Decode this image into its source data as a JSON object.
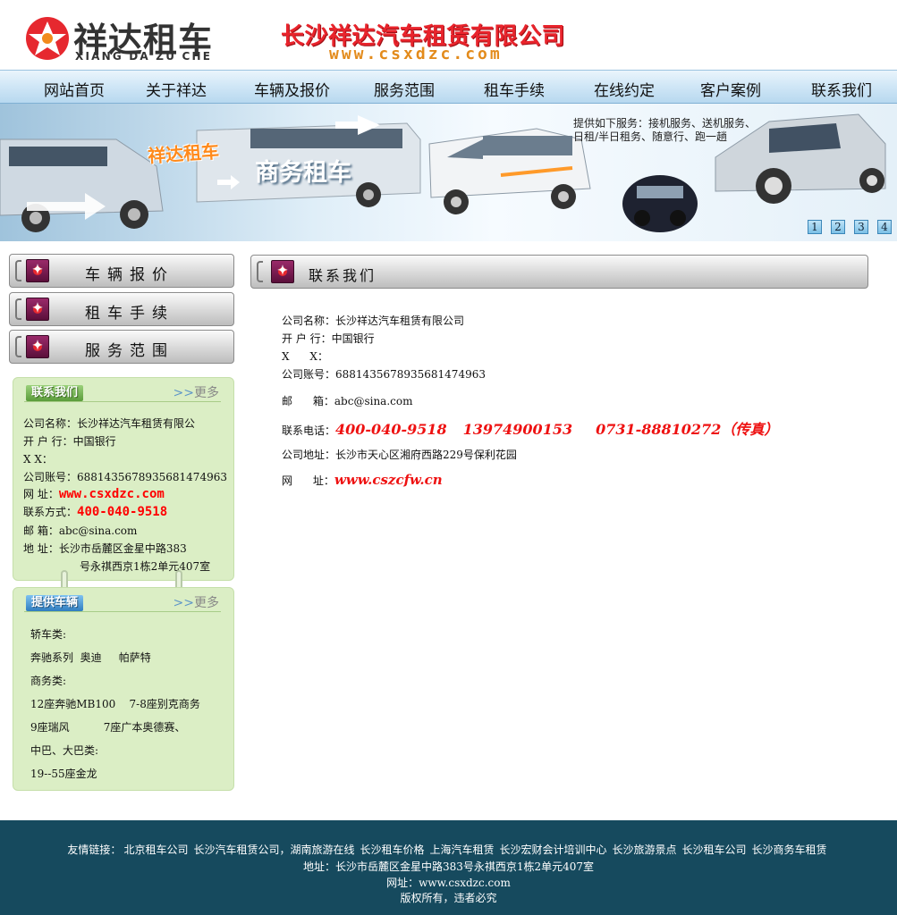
{
  "header": {
    "logo_cn": "祥达租车",
    "logo_en": "XIANG DA ZU CHE",
    "company_title": "长沙祥达汽车租赁有限公司",
    "company_url": "www.csxdzc.com"
  },
  "nav": {
    "items": [
      "网站首页",
      "关于祥达",
      "车辆及报价",
      "服务范围",
      "租车手续",
      "在线约定",
      "客户案例",
      "联系我们"
    ]
  },
  "banner": {
    "slogan": "祥达租车",
    "title": "商务租车",
    "services": "提供如下服务：接机服务、送机服务、日租/半日租务、随意行、跑一趟",
    "pages": [
      "1",
      "2",
      "3",
      "4"
    ]
  },
  "sidebar": {
    "buttons": [
      "车辆报价",
      "租车手续",
      "服务范围"
    ],
    "contact": {
      "tag": "联系我们",
      "more": "更多",
      "more_arrows": ">>",
      "lines": [
        {
          "label": "公司名称：",
          "value": "长沙祥达汽车租赁有限公"
        },
        {
          "label": "开 户 行：",
          "value": "中国银行"
        },
        {
          "label": "X      X：",
          "value": ""
        },
        {
          "label": "公司账号：",
          "value": "6881435678935681474963"
        },
        {
          "label": "网      址：",
          "value": "www.csxdzc.com"
        },
        {
          "label": "联系方式：",
          "value": "400-040-9518"
        },
        {
          "label": "邮      箱：",
          "value": "abc@sina.com"
        },
        {
          "label": "地      址：",
          "value": "长沙市岳麓区金星中路383"
        }
      ],
      "address_cont": "号永祺西京1栋2单元407室"
    },
    "vehicles": {
      "tag": "提供车辆",
      "more": "更多",
      "more_arrows": ">>",
      "rows": [
        "轿车类:",
        "奔驰系列  奥迪     帕萨特",
        "商务类:",
        "12座奔驰MB100    7-8座别克商务",
        "9座瑞风          7座广本奥德赛、",
        "中巴、大巴类:",
        "19--55座金龙"
      ]
    }
  },
  "main": {
    "title": "联系我们",
    "company_label": "公司名称：",
    "company_value": "长沙祥达汽车租赁有限公司",
    "bank_label": "开 户 行：",
    "bank_value": "中国银行",
    "xx_label": "X      X：",
    "account_label": "公司账号：",
    "account_value": "6881435678935681474963",
    "email_label": "邮      箱：",
    "email_value": "abc@sina.com",
    "phone_label": "联系电话：",
    "phone_1": "400-040-9518",
    "phone_2": "13974900153",
    "phone_3": "0731-88810272（传真）",
    "address_label": "公司地址：",
    "address_value": "长沙市天心区湘府西路229号保利花园",
    "website_label": "网      址：",
    "website_value": "www.cszcfw.cn"
  },
  "footer": {
    "links_label": "友情链接：",
    "links": [
      "北京租车公司",
      "长沙汽车租赁公司，湖南旅游在线",
      "长沙租车价格",
      "上海汽车租赁",
      "长沙宏财会计培训中心",
      "长沙旅游景点",
      "长沙租车公司",
      "长沙商务车租赁"
    ],
    "address": "地址：长沙市岳麓区金星中路383号永祺西京1栋2单元407室",
    "website": "网址：www.csxdzc.com",
    "copyright": "版权所有，违者必究"
  },
  "colors": {
    "footer_bg": "#164a5e",
    "accent_red": "#e11",
    "panel_green": "#dbeec5",
    "nav_blue": "#cfe6f6"
  }
}
